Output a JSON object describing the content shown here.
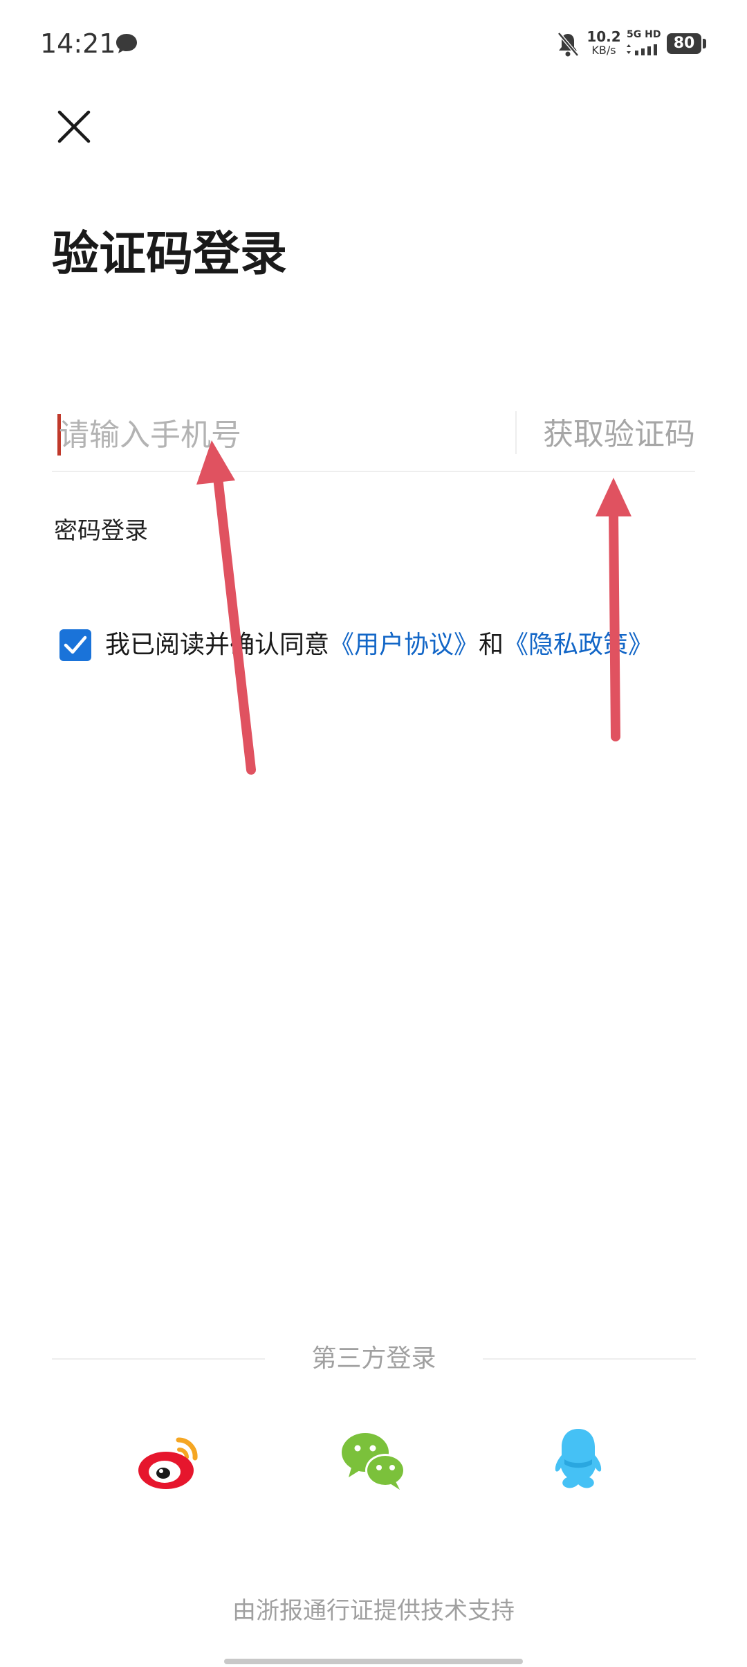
{
  "status_bar": {
    "time": "14:21",
    "net_speed_value": "10.2",
    "net_speed_unit": "KB/s",
    "network": "5G HD",
    "battery": "80"
  },
  "login": {
    "title": "验证码登录",
    "phone_placeholder": "请输入手机号",
    "get_code": "获取验证码",
    "password_login": "密码登录",
    "agreement": {
      "checked": true,
      "prefix": "我已阅读并确认同意",
      "user_agreement": "《用户协议》",
      "and": "和",
      "privacy_policy": "《隐私政策》"
    }
  },
  "third_party": {
    "title": "第三方登录",
    "providers": [
      "weibo-icon",
      "wechat-icon",
      "qq-icon"
    ]
  },
  "footer": {
    "text": "由浙报通行证提供技术支持"
  },
  "colors": {
    "accent": "#1a73d9",
    "link": "#1266c7",
    "annotation": "#e05260"
  }
}
